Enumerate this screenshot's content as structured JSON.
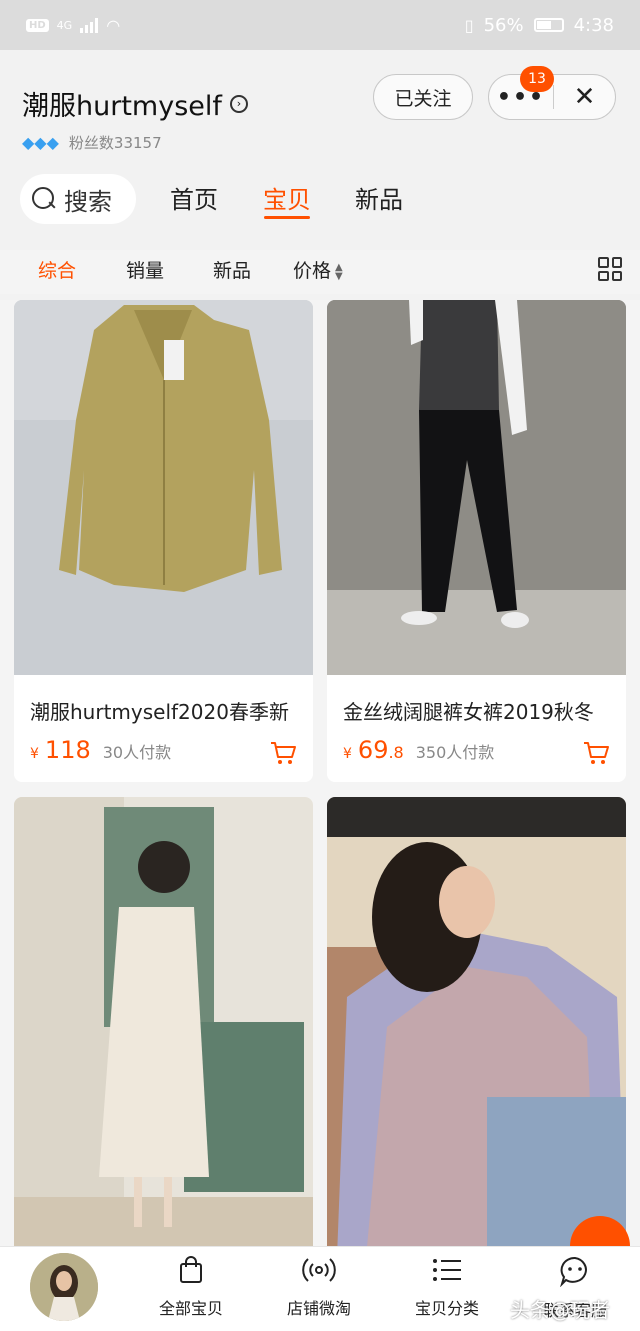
{
  "status_bar": {
    "hd": "HD",
    "network": "4G",
    "battery": "56%",
    "time": "4:38"
  },
  "shop": {
    "name": "潮服hurtmyself",
    "fans": "粉丝数33157"
  },
  "header_buttons": {
    "follow": "已关注",
    "more_badge": "13",
    "more": "•••",
    "close": "✕"
  },
  "search": {
    "label": "搜索"
  },
  "tabs": [
    {
      "label": "首页"
    },
    {
      "label": "宝贝"
    },
    {
      "label": "新品"
    }
  ],
  "sort": [
    {
      "label": "综合"
    },
    {
      "label": "销量"
    },
    {
      "label": "新品"
    },
    {
      "label": "价格"
    }
  ],
  "products": [
    {
      "title": "潮服hurtmyself2020春季新",
      "price_int": "118",
      "price_dec": "",
      "sold": "30人付款"
    },
    {
      "title": "金丝绒阔腿裤女裤2019秋冬",
      "price_int": "69",
      "price_dec": ".8",
      "sold": "350人付款"
    }
  ],
  "currency": "¥",
  "bottom_nav": [
    {
      "label": "全部宝贝"
    },
    {
      "label": "店铺微淘"
    },
    {
      "label": "宝贝分类"
    },
    {
      "label": "联系客服"
    }
  ],
  "watermark": "头条@玩者",
  "colors": {
    "accent": "#ff5000",
    "background": "#f4f4f4"
  }
}
